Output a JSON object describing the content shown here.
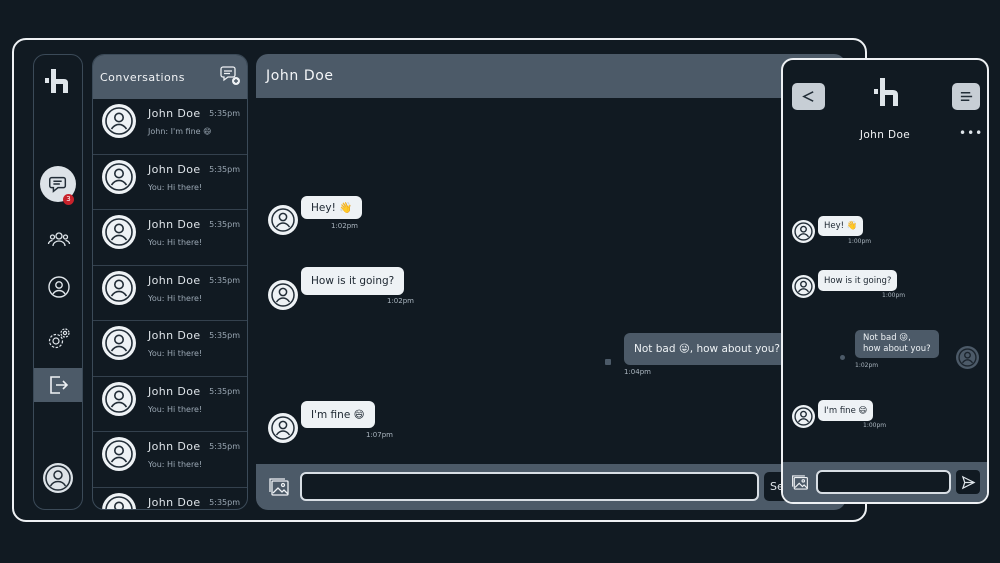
{
  "sidebar": {
    "badge_count": "3"
  },
  "conversations": {
    "title": "Conversations",
    "items": [
      {
        "name": "John Doe",
        "time": "5:35pm",
        "preview": "John: I'm fine 😄"
      },
      {
        "name": "John Doe",
        "time": "5:35pm",
        "preview": "You: Hi there!"
      },
      {
        "name": "John Doe",
        "time": "5:35pm",
        "preview": "You: Hi there!"
      },
      {
        "name": "John Doe",
        "time": "5:35pm",
        "preview": "You: Hi there!"
      },
      {
        "name": "John Doe",
        "time": "5:35pm",
        "preview": "You: Hi there!"
      },
      {
        "name": "John Doe",
        "time": "5:35pm",
        "preview": "You: Hi there!"
      },
      {
        "name": "John Doe",
        "time": "5:35pm",
        "preview": "You: Hi there!"
      },
      {
        "name": "John Doe",
        "time": "5:35pm",
        "preview": ""
      }
    ]
  },
  "chat": {
    "title": "John Doe",
    "messages": [
      {
        "text": "Hey! 👋",
        "time": "1:02pm"
      },
      {
        "text": "How is it going?",
        "time": "1:02pm"
      },
      {
        "text": "Not bad 😜, how about you?",
        "time": "1:04pm"
      },
      {
        "text": "I'm fine 😄",
        "time": "1:07pm"
      }
    ],
    "input_value": "",
    "send_label": "Send"
  },
  "mobile": {
    "name": "John Doe",
    "more": "•••",
    "messages": [
      {
        "text": "Hey! 👋",
        "time": "1:00pm"
      },
      {
        "text": "How is it going?",
        "time": "1:00pm"
      },
      {
        "text_line1": "Not bad 😜,",
        "text_line2": "how about you?",
        "time": "1:02pm"
      },
      {
        "text": "I'm fine 😄",
        "time": "1:00pm"
      }
    ],
    "input_value": ""
  },
  "colors": {
    "background": "#111a22",
    "panel": "#4c5a68",
    "bubble_in": "#eef2f5",
    "badge": "#c8222b"
  }
}
